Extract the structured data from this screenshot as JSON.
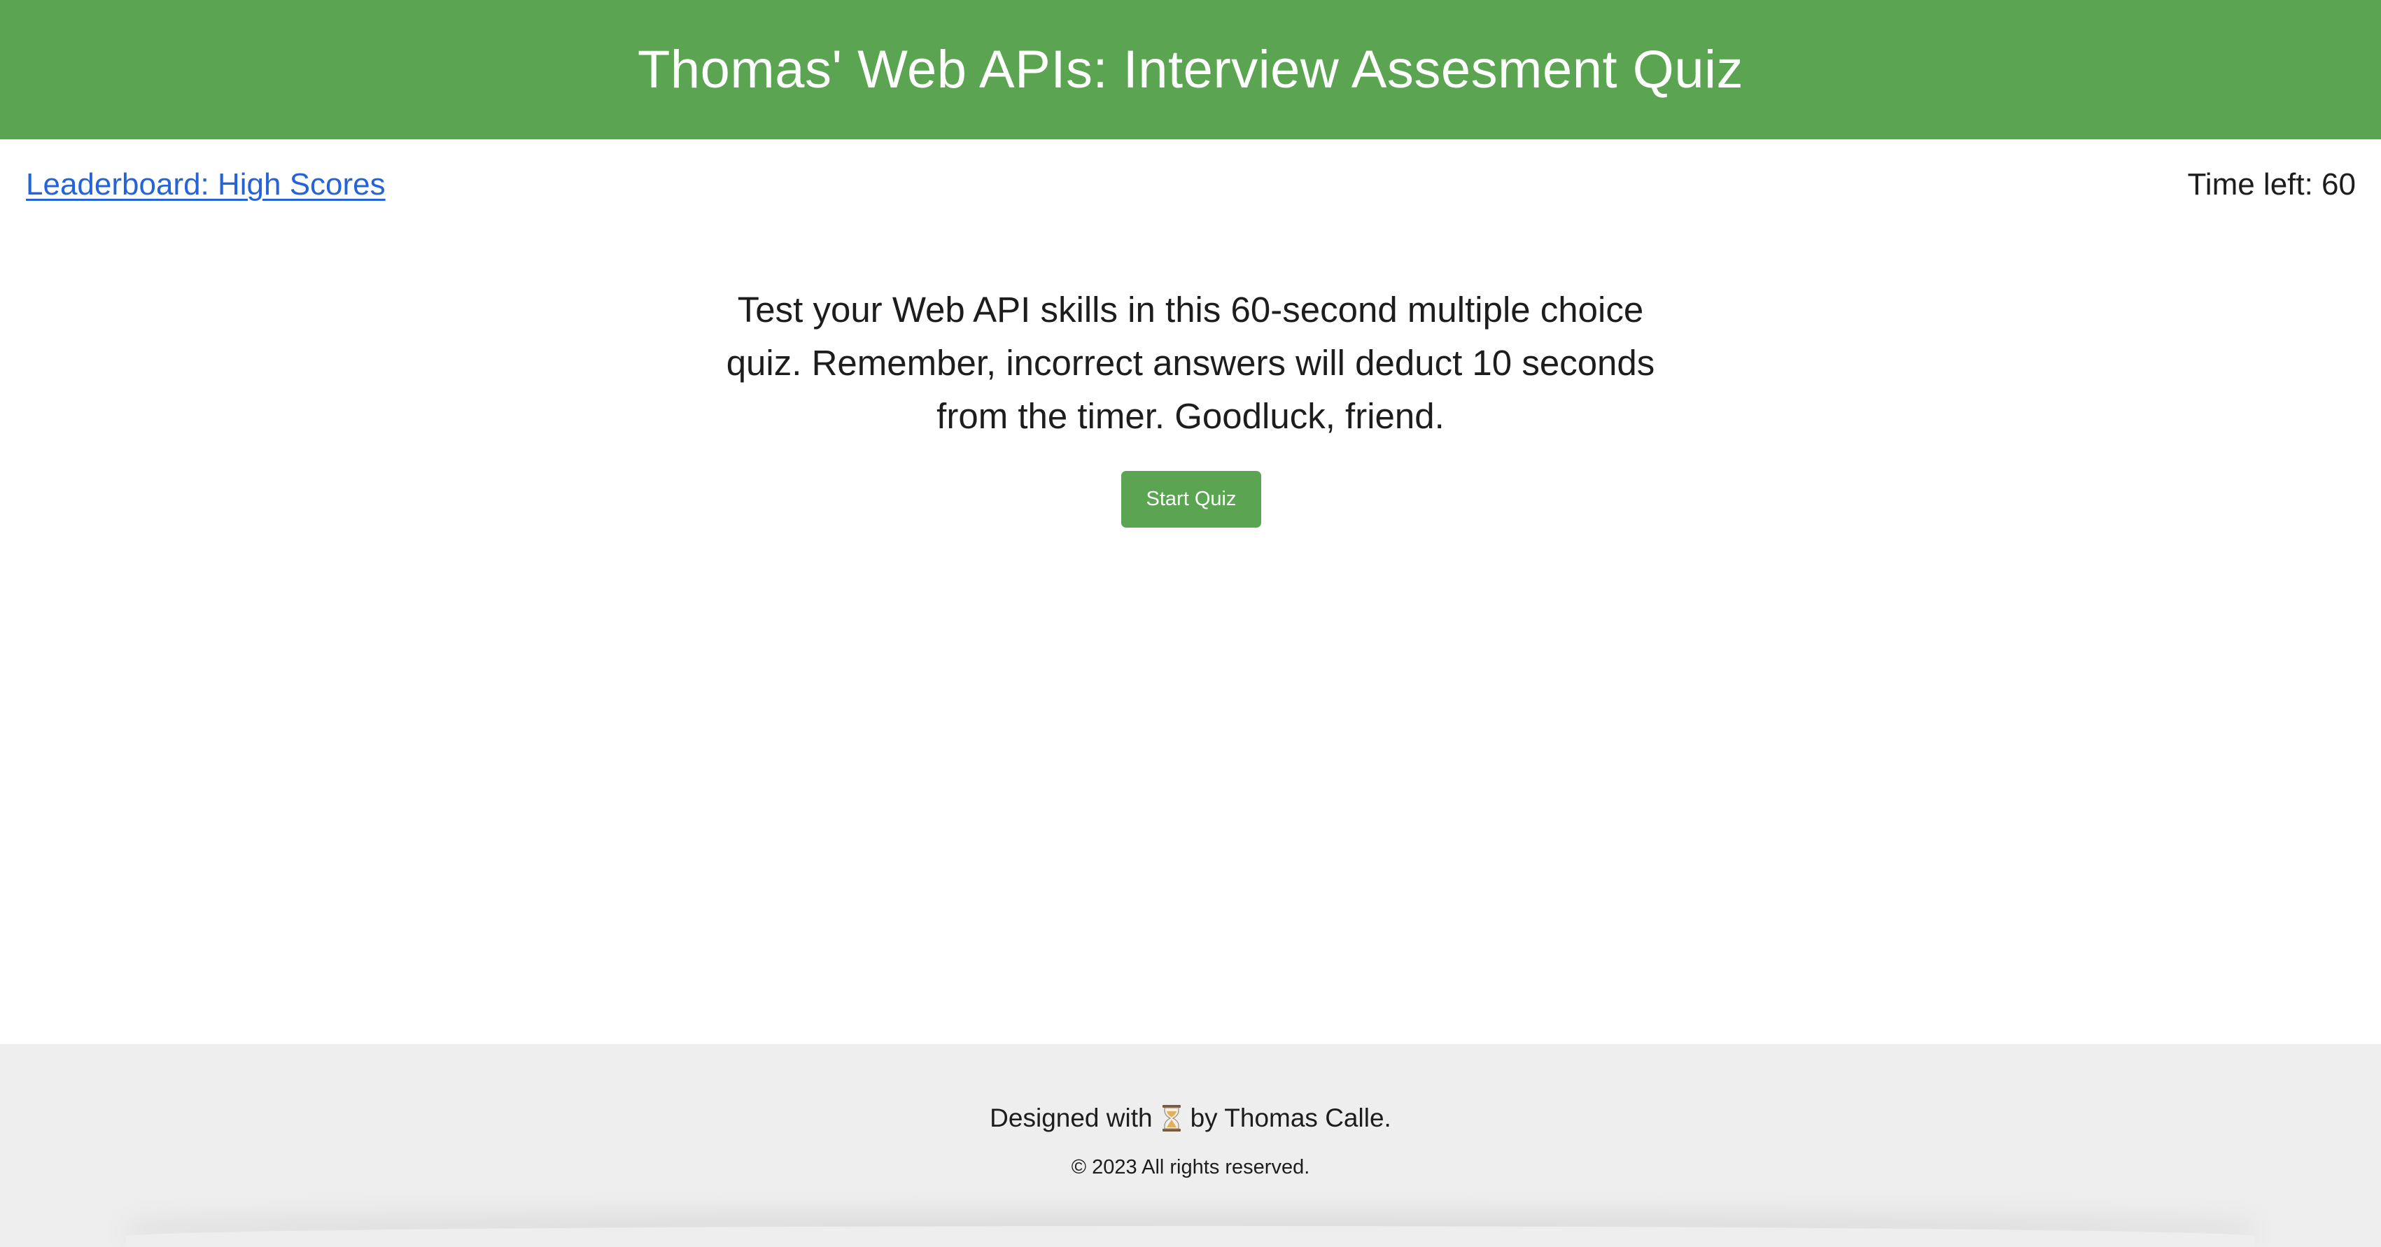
{
  "header": {
    "title": "Thomas' Web APIs: Interview Assesment Quiz"
  },
  "nav": {
    "leaderboard_label": "Leaderboard: High Scores",
    "timer_text": "Time left: 60"
  },
  "intro": {
    "text": "Test your Web API skills in this 60-second multiple choice quiz. Remember, incorrect answers will deduct 10 seconds from the timer. Goodluck, friend.",
    "start_button_label": "Start Quiz"
  },
  "footer": {
    "credit_prefix": "Designed with",
    "credit_icon": "hourglass-icon",
    "credit_suffix": "by Thomas Calle.",
    "copyright": "© 2023 All rights reserved."
  },
  "colors": {
    "brand_green": "#5ba452",
    "link_blue": "#2563d9",
    "footer_bg": "#eeeeee"
  }
}
